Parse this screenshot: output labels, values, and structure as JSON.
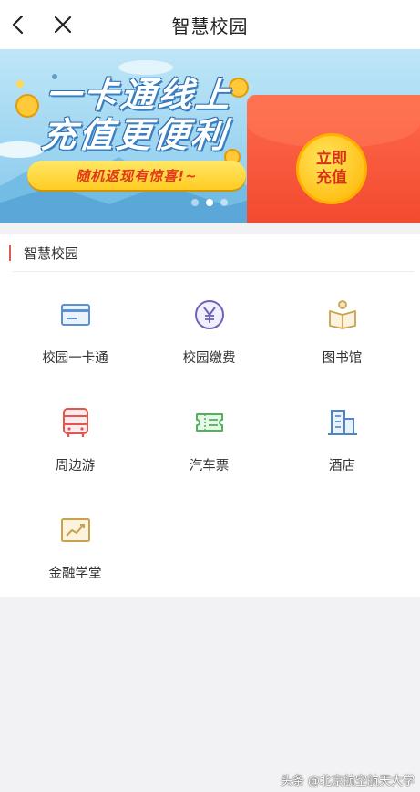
{
  "nav": {
    "title": "智慧校园",
    "back_icon": "chevron-left-icon",
    "close_icon": "close-icon"
  },
  "banner": {
    "headline_line1": "一卡通线上",
    "headline_line2": "充值更便利",
    "promo": "随机返现有惊喜!~",
    "recharge_line1": "立即",
    "recharge_line2": "充值",
    "carousel_index": 1,
    "carousel_count": 3
  },
  "section": {
    "title": "智慧校园",
    "accent_color": "#e05a52",
    "items": [
      {
        "label": "校园一卡通",
        "icon": "card-icon"
      },
      {
        "label": "校园缴费",
        "icon": "yuan-icon"
      },
      {
        "label": "图书馆",
        "icon": "book-icon"
      },
      {
        "label": "周边游",
        "icon": "bus-icon"
      },
      {
        "label": "汽车票",
        "icon": "ticket-icon"
      },
      {
        "label": "酒店",
        "icon": "building-icon"
      },
      {
        "label": "金融学堂",
        "icon": "chart-icon"
      }
    ]
  },
  "watermark": "头条 @北京航空航天大学"
}
